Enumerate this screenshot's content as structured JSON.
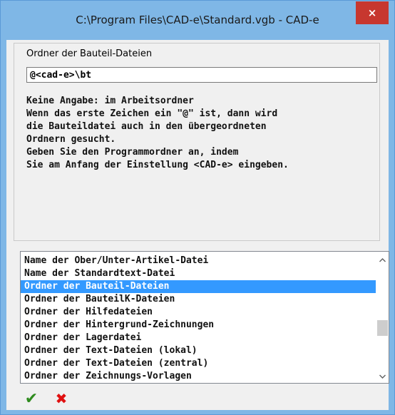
{
  "window": {
    "title": "C:\\Program Files\\CAD-e\\Standard.vgb - CAD-e",
    "close_icon": "×"
  },
  "setting": {
    "label": "Ordner der Bauteil-Dateien",
    "value": "@<cad-e>\\bt"
  },
  "help": {
    "lines": [
      "Keine Angabe: im Arbeitsordner",
      "Wenn das erste Zeichen ein \"@\" ist, dann wird",
      "die Bauteildatei auch in den übergeordneten",
      "Ordnern gesucht.",
      "Geben Sie den Programmordner an, indem",
      "Sie am Anfang der Einstellung <CAD-e> eingeben."
    ]
  },
  "list": {
    "selected_index": 2,
    "items": [
      "Name der Ober/Unter-Artikel-Datei",
      "Name der Standardtext-Datei",
      "Ordner der Bauteil-Dateien",
      "Ordner der BauteilK-Dateien",
      "Ordner der Hilfedateien",
      "Ordner der Hintergrund-Zeichnungen",
      "Ordner der Lagerdatei",
      "Ordner der Text-Dateien (lokal)",
      "Ordner der Text-Dateien (zentral)",
      "Ordner der Zeichnungs-Vorlagen"
    ],
    "scroll_up_icon": "chevron-up-icon",
    "scroll_down_icon": "chevron-down-icon"
  },
  "buttons": {
    "ok_icon": "checkmark-icon",
    "ok_glyph": "✔",
    "cancel_icon": "cross-icon",
    "cancel_glyph": "✖"
  },
  "colors": {
    "titlebar": "#7fb7e6",
    "close": "#c7372f",
    "selection": "#3399ff",
    "ok": "#2e8b1e",
    "cancel": "#e01010"
  }
}
